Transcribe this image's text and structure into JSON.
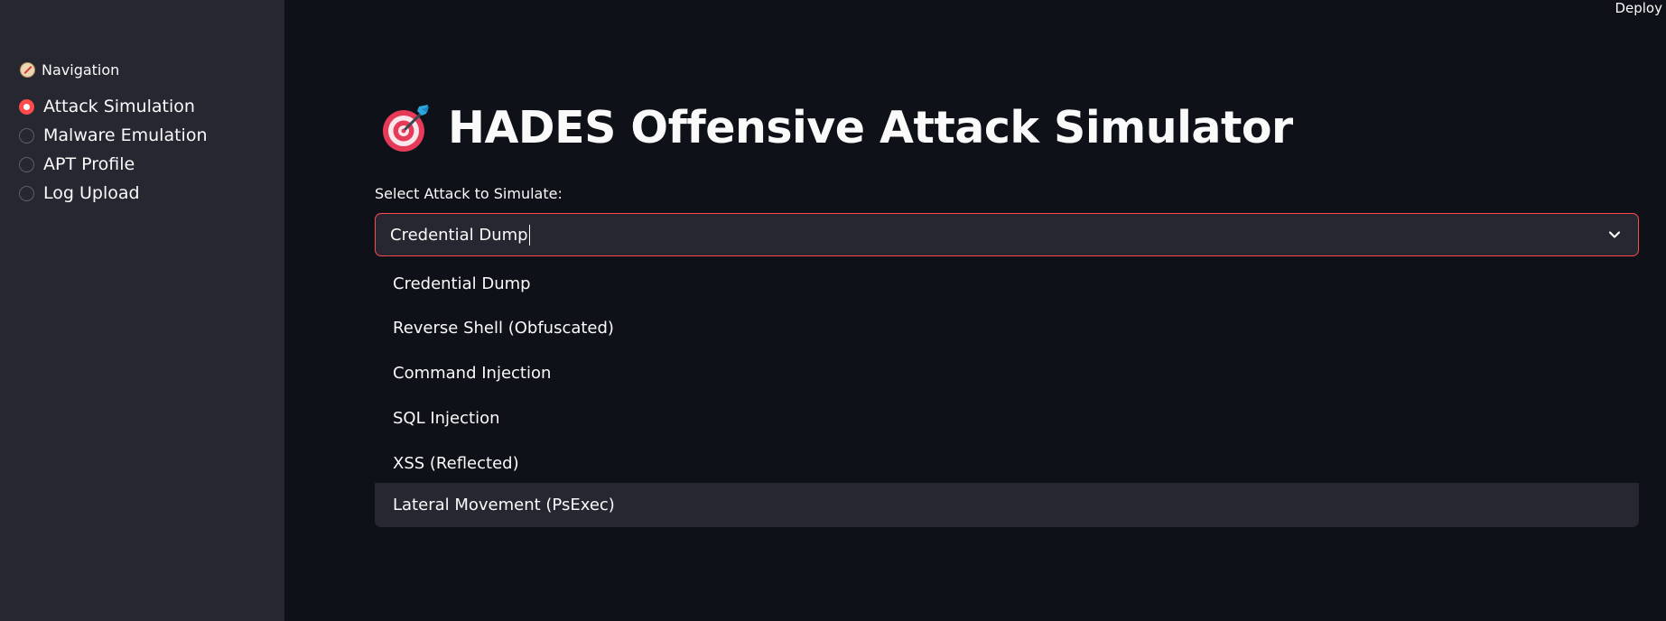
{
  "header": {
    "deploy_label": "Deploy"
  },
  "sidebar": {
    "title": "Navigation",
    "title_icon": "compass-icon",
    "items": [
      {
        "label": "Attack Simulation",
        "selected": true
      },
      {
        "label": "Malware Emulation",
        "selected": false
      },
      {
        "label": "APT Profile",
        "selected": false
      },
      {
        "label": "Log Upload",
        "selected": false
      }
    ]
  },
  "main": {
    "title": "HADES Offensive Attack Simulator",
    "title_icon": "direct-hit-target-icon",
    "select": {
      "label": "Select Attack to Simulate:",
      "value": "Credential Dump",
      "options": [
        "Credential Dump",
        "Reverse Shell (Obfuscated)",
        "Command Injection",
        "SQL Injection",
        "XSS (Reflected)",
        "Lateral Movement (PsExec)"
      ],
      "highlighted_option": "Lateral Movement (PsExec)"
    }
  },
  "colors": {
    "background": "#0e1117",
    "sidebar": "#262730",
    "accent": "#ff4b4b",
    "text": "#fafafa"
  }
}
